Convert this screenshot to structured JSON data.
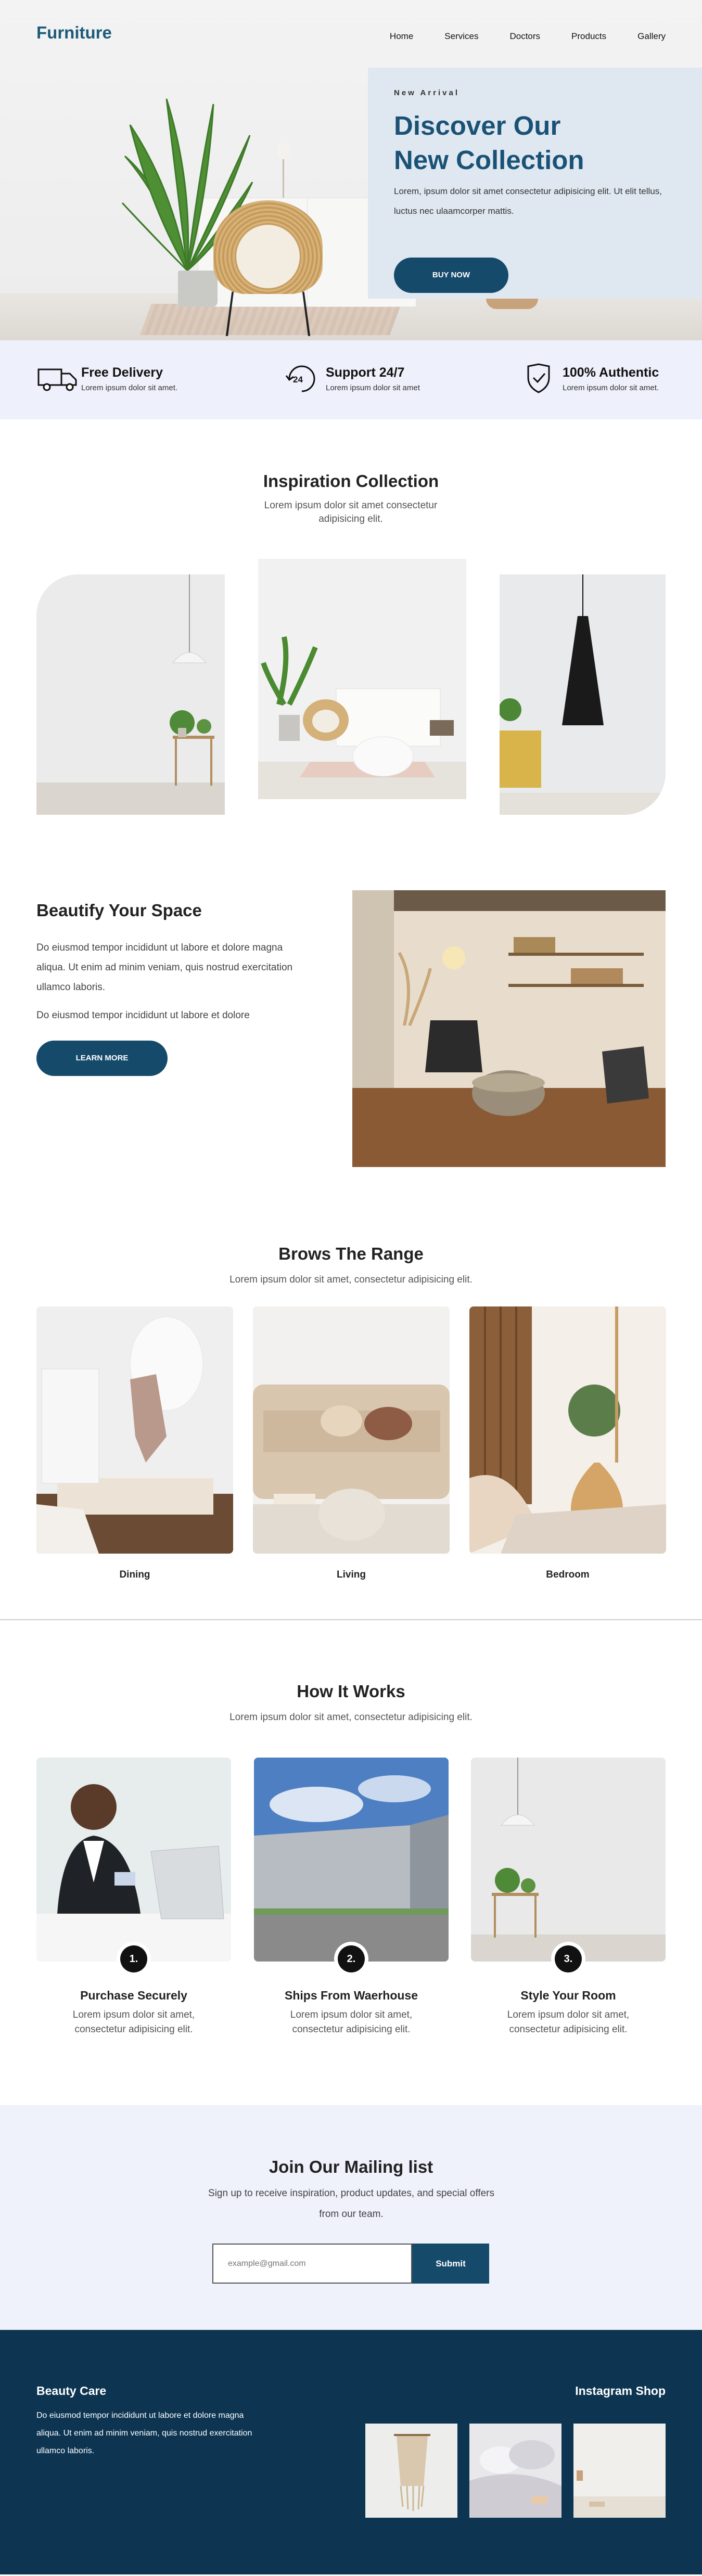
{
  "nav": {
    "brand": "Furniture",
    "items": [
      "Home",
      "Services",
      "Doctors",
      "Products",
      "Gallery"
    ]
  },
  "hero": {
    "kicker": "New Arrival",
    "title_line1": "Discover Our",
    "title_line2": "New Collection",
    "text": "Lorem, ipsum dolor sit amet consectetur adipisicing elit. Ut elit tellus, luctus nec ulaamcorper mattis.",
    "button": "BUY NOW"
  },
  "features": [
    {
      "icon": "truck-icon",
      "title": "Free Delivery",
      "sub": "Lorem ipsum dolor sit amet."
    },
    {
      "icon": "support-24-icon",
      "title": "Support 24/7",
      "sub": "Lorem ipsum dolor sit amet"
    },
    {
      "icon": "shield-check-icon",
      "title": "100% Authentic",
      "sub": "Lorem ipsum dolor sit amet."
    }
  ],
  "inspiration": {
    "title": "Inspiration Collection",
    "subtitle": "Lorem ipsum dolor sit amet consectetur adipisicing elit."
  },
  "beautify": {
    "title": "Beautify Your Space",
    "p1": "Do eiusmod tempor incididunt ut labore et dolore magna aliqua. Ut enim ad minim veniam, quis nostrud exercitation ullamco laboris.",
    "p2": "Do eiusmod tempor incididunt ut labore et dolore",
    "button": "LEARN MORE"
  },
  "range": {
    "title": "Brows The Range",
    "subtitle": "Lorem ipsum dolor sit amet, consectetur adipisicing elit.",
    "items": [
      "Dining",
      "Living",
      "Bedroom"
    ]
  },
  "how": {
    "title": "How It Works",
    "subtitle": "Lorem ipsum dolor sit amet, consectetur adipisicing elit.",
    "steps": [
      {
        "num": "1.",
        "title": "Purchase Securely",
        "sub": "Lorem ipsum dolor sit amet, consectetur adipisicing elit."
      },
      {
        "num": "2.",
        "title": "Ships From Waerhouse",
        "sub": "Lorem ipsum dolor sit amet, consectetur adipisicing elit."
      },
      {
        "num": "3.",
        "title": "Style Your Room",
        "sub": "Lorem ipsum dolor sit amet, consectetur adipisicing elit."
      }
    ]
  },
  "mailing": {
    "title": "Join Our Mailing list",
    "subtitle": "Sign up to receive inspiration, product updates, and special offers from our team.",
    "placeholder": "example@gmail.com",
    "button": "Submit"
  },
  "footer": {
    "title": "Beauty Care",
    "text": "Do eiusmod tempor incididunt ut labore et dolore magna aliqua. Ut enim ad minim veniam, quis nostrud exercitation ullamco laboris.",
    "insta_title": "Instagram Shop"
  },
  "colors": {
    "primary": "#164a6b",
    "brand": "#1d5b7a",
    "footer_bg": "#0d3552",
    "light_bg": "#eef0fb"
  }
}
